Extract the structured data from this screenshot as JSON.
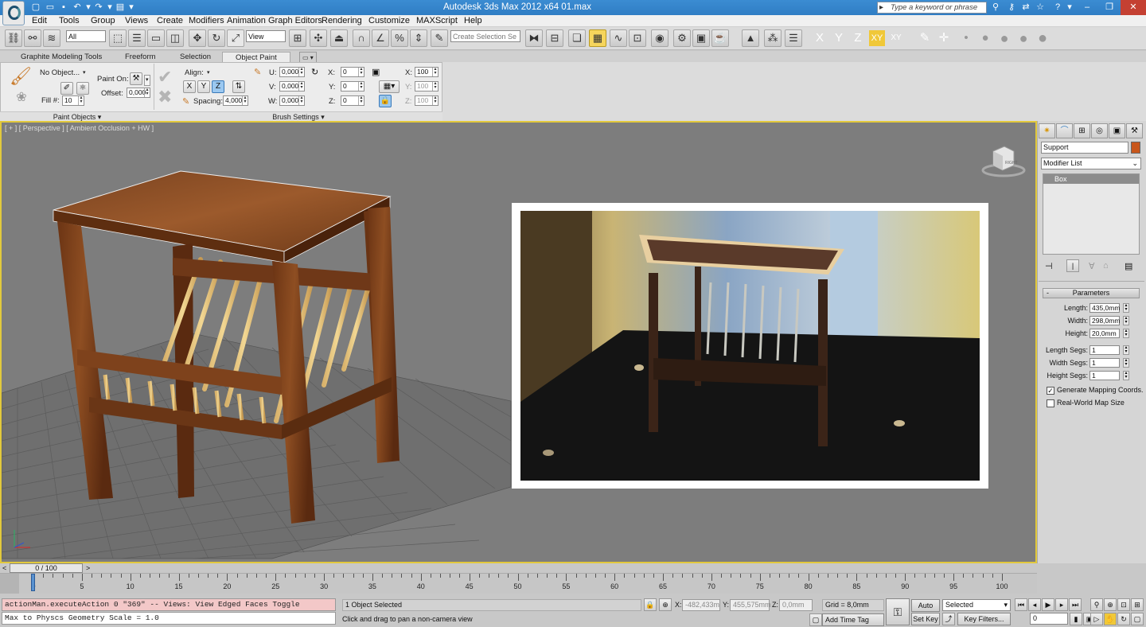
{
  "window": {
    "title": "Autodesk 3ds Max  2012 x64      01.max",
    "search_placeholder": "Type a keyword or phrase"
  },
  "menu": [
    "Edit",
    "Tools",
    "Group",
    "Views",
    "Create",
    "Modifiers",
    "Animation",
    "Graph Editors",
    "Rendering",
    "Customize",
    "MAXScript",
    "Help"
  ],
  "toolbar": {
    "selection_filter": "All",
    "ref_coord": "View",
    "named_selection_placeholder": "Create Selection Se",
    "axes": [
      "X",
      "Y",
      "Z",
      "XY",
      "XY"
    ]
  },
  "ribbon": {
    "tabs": [
      "Graphite Modeling Tools",
      "Freeform",
      "Selection",
      "Object Paint"
    ],
    "active_tab": "Object Paint",
    "paint_objects": {
      "object": "No Object...",
      "paint_on_label": "Paint On:",
      "offset_label": "Offset:",
      "offset": "0,000",
      "fill_label": "Fill #:",
      "fill": "10",
      "group_label": "Paint Objects"
    },
    "brush": {
      "align_label": "Align:",
      "align_axes": [
        "X",
        "Y",
        "Z"
      ],
      "spacing_label": "Spacing:",
      "spacing": "4,000",
      "u_label": "U:",
      "u": "0,000",
      "v_label": "V:",
      "v": "0,000",
      "w_label": "W:",
      "w": "0,000",
      "rx_label": "X:",
      "rx": "0",
      "ry_label": "Y:",
      "ry": "0",
      "rz_label": "Z:",
      "rz": "0",
      "sx_label": "X:",
      "sx": "100",
      "sy_label": "Y:",
      "sy": "100",
      "sz_label": "Z:",
      "sz": "100",
      "group_label": "Brush Settings"
    }
  },
  "viewport": {
    "label": "[ + ] [ Perspective ] [ Ambient Occlusion + HW ]",
    "navcube_face": "RIGHT"
  },
  "command_panel": {
    "object_name": "Support",
    "object_color": "#c8561b",
    "modifier_list": "Modifier List",
    "stack_item": "Box",
    "rollout": "Parameters",
    "params": [
      {
        "label": "Length:",
        "value": "435,0mm"
      },
      {
        "label": "Width:",
        "value": "298,0mm"
      },
      {
        "label": "Height:",
        "value": "20,0mm"
      }
    ],
    "segs": [
      {
        "label": "Length Segs:",
        "value": "1"
      },
      {
        "label": "Width Segs:",
        "value": "1"
      },
      {
        "label": "Height Segs:",
        "value": "1"
      }
    ],
    "gen_mapping": "Generate Mapping Coords.",
    "real_world": "Real-World Map Size"
  },
  "timeline": {
    "frame_display": "0 / 100",
    "ticks": [
      "0",
      "5",
      "10",
      "15",
      "20",
      "25",
      "30",
      "35",
      "40",
      "45",
      "50",
      "55",
      "60",
      "65",
      "70",
      "75",
      "80",
      "85",
      "90",
      "95",
      "100"
    ]
  },
  "status": {
    "listener_line1": "actionMan.executeAction 0 \"369\"  -- Views: View Edged Faces Toggle",
    "listener_line2": "Max to Physcs Geometry Scale = 1.0",
    "selected": "1 Object Selected",
    "prompt": "Click and drag to pan a non-camera view",
    "x_label": "X:",
    "x": "-482,433m",
    "y_label": "Y:",
    "y": "455,575mm",
    "z_label": "Z:",
    "z": "0,0mm",
    "grid": "Grid = 8,0mm",
    "add_time_tag": "Add Time Tag",
    "auto_key": "Auto Key",
    "set_key": "Set Key",
    "key_mode": "Selected",
    "key_filters": "Key Filters...",
    "current_frame": "0"
  }
}
